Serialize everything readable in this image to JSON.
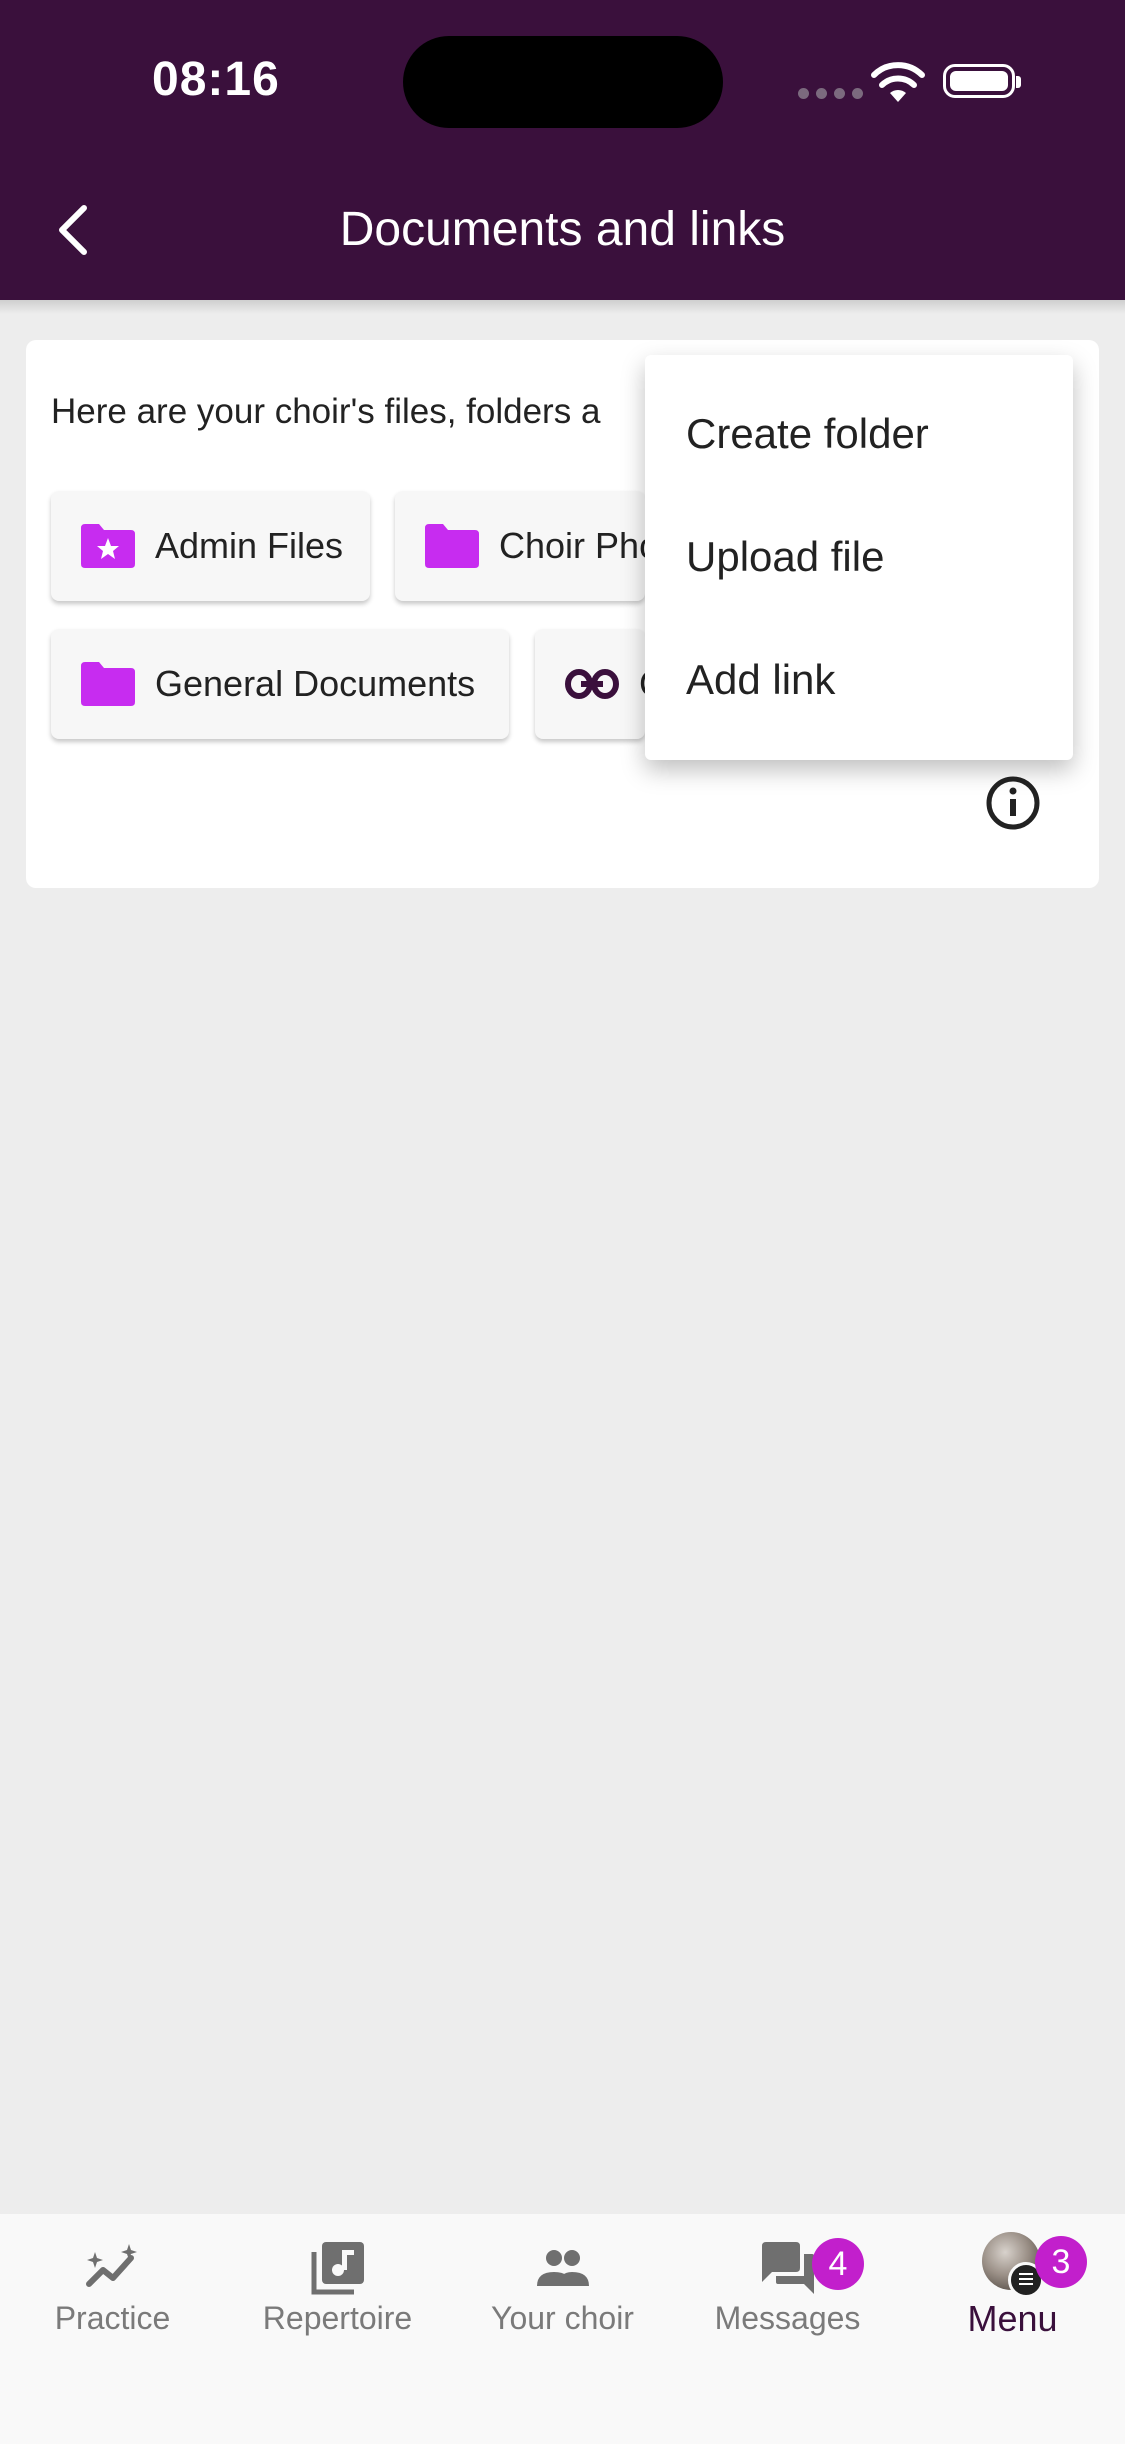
{
  "status_bar": {
    "time": "08:16"
  },
  "header": {
    "title": "Documents and links"
  },
  "card": {
    "intro": "Here are your choir's files, folders a",
    "chips": [
      {
        "label": "Admin Files",
        "icon": "star-folder-icon"
      },
      {
        "label": "Choir Pho",
        "icon": "folder-icon"
      },
      {
        "label": "General Documents",
        "icon": "folder-icon"
      },
      {
        "label": "C",
        "icon": "link-icon"
      }
    ]
  },
  "dropdown": {
    "items": [
      "Create folder",
      "Upload file",
      "Add link"
    ]
  },
  "bottom_nav": {
    "items": [
      {
        "label": "Practice",
        "icon": "practice-icon"
      },
      {
        "label": "Repertoire",
        "icon": "repertoire-icon"
      },
      {
        "label": "Your choir",
        "icon": "people-icon"
      },
      {
        "label": "Messages",
        "icon": "messages-icon",
        "badge": "4"
      },
      {
        "label": "Menu",
        "icon": "avatar",
        "badge": "3",
        "active": true
      }
    ]
  },
  "colors": {
    "header_bg": "#3a103c",
    "folder": "#c72cf0",
    "badge": "#c21fcc",
    "active_nav": "#3a103c"
  }
}
